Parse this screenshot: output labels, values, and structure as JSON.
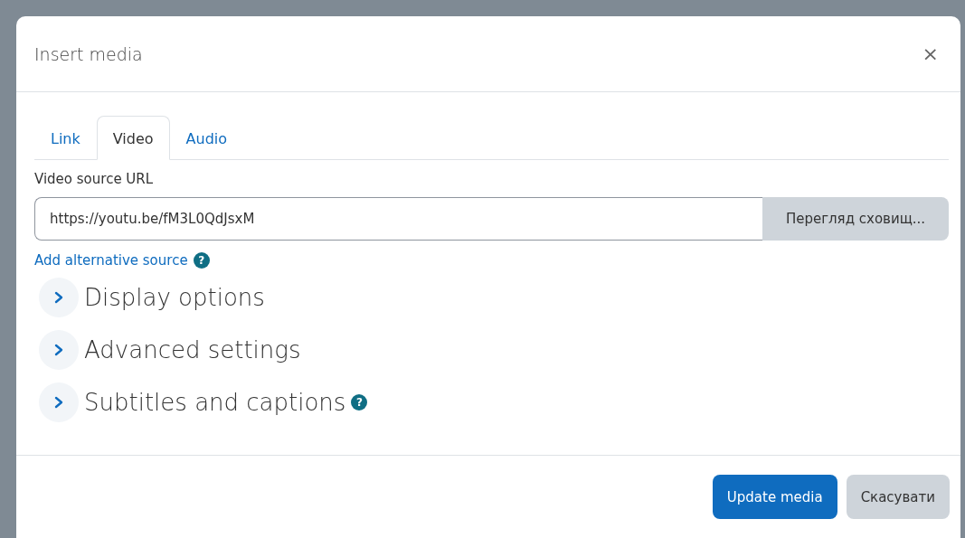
{
  "dialog": {
    "title": "Insert media",
    "close": "×"
  },
  "tabs": [
    {
      "label": "Link",
      "selected": false
    },
    {
      "label": "Video",
      "selected": true
    },
    {
      "label": "Audio",
      "selected": false
    }
  ],
  "source": {
    "label": "Video source URL",
    "value": "https://youtu.be/fM3L0QdJsxM",
    "browse": "Перегляд сховищ..."
  },
  "add_source": {
    "label": "Add alternative source",
    "help": "?"
  },
  "sections": [
    {
      "title": "Display options",
      "expanded": false
    },
    {
      "title": "Advanced settings",
      "expanded": false
    },
    {
      "title": "Subtitles and captions",
      "expanded": false,
      "help": "?"
    }
  ],
  "buttons": [
    {
      "label": "Update media",
      "kind": "primary"
    },
    {
      "label": "Скасувати",
      "kind": "secondary"
    }
  ]
}
